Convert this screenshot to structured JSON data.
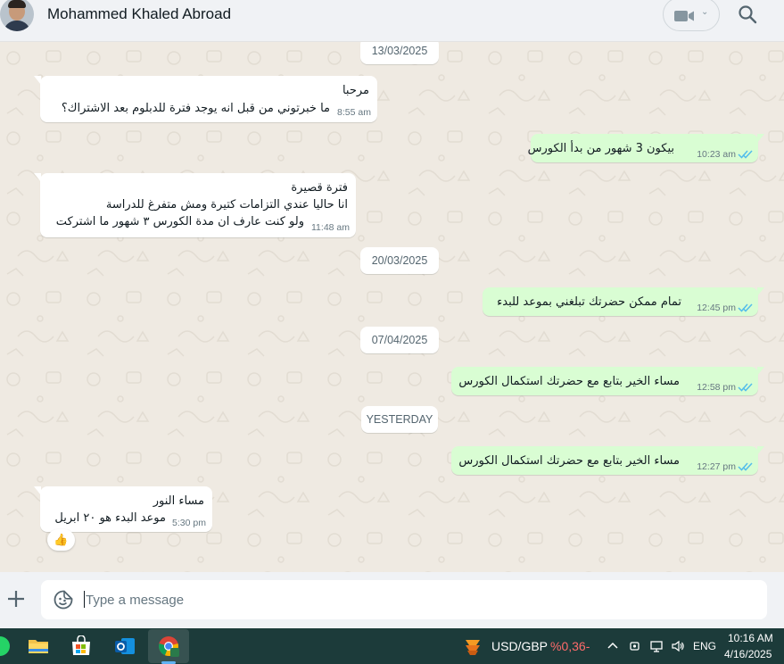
{
  "header": {
    "contact_name": "Mohammed Khaled Abroad",
    "icons": [
      "avatar",
      "video-call-icon",
      "chevron-down-icon",
      "search-icon"
    ]
  },
  "chat": {
    "dates": [
      "13/03/2025",
      "20/03/2025",
      "07/04/2025",
      "YESTERDAY"
    ],
    "messages": [
      {
        "direction": "incoming",
        "lines": [
          "مرحبا",
          "ما خبرتوني من قبل انه يوجد فترة للدبلوم بعد الاشتراك؟"
        ],
        "time": "8:55 am"
      },
      {
        "direction": "outgoing",
        "lines": [
          "بيكون 3 شهور من بدأ الكورس"
        ],
        "time": "10:23 am",
        "status": "read"
      },
      {
        "direction": "incoming",
        "lines": [
          "فترة قصيرة",
          "انا حاليا عندي التزامات كتيرة ومش متفرغ للدراسة",
          "ولو كنت عارف ان مدة الكورس ٣ شهور ما اشتركت"
        ],
        "time": "11:48 am"
      },
      {
        "direction": "outgoing",
        "lines": [
          "تمام ممكن حضرتك تبلغني بموعد للبدء"
        ],
        "time": "12:45 pm",
        "status": "read"
      },
      {
        "direction": "outgoing",
        "lines": [
          "مساء الخير بتابع مع حضرتك استكمال الكورس"
        ],
        "time": "12:58 pm",
        "status": "read"
      },
      {
        "direction": "outgoing",
        "lines": [
          "مساء الخير بتابع مع حضرتك استكمال الكورس"
        ],
        "time": "12:27 pm",
        "status": "read"
      },
      {
        "direction": "incoming",
        "lines": [
          "مساء النور",
          "موعد البدء هو ٢٠ ابريل"
        ],
        "time": "5:30 pm"
      }
    ],
    "reaction": "👍"
  },
  "composer": {
    "placeholder": "Type a message",
    "icons": [
      "plus-icon",
      "sticker-icon"
    ]
  },
  "taskbar": {
    "apps": [
      "whatsapp-icon",
      "file-explorer-icon",
      "microsoft-store-icon",
      "outlook-icon",
      "chrome-icon"
    ],
    "ticker_symbol": "USD/GBP",
    "ticker_change": "%0,36-",
    "ticker_change_color": "#ff6b6b",
    "language": "ENG",
    "time": "10:16 AM",
    "date": "4/16/2025"
  },
  "colors": {
    "incoming_bubble": "#ffffff",
    "outgoing_bubble": "#d9fdd3",
    "read_ticks": "#53bdeb",
    "chat_background": "#efeae2",
    "taskbar_background": "#1c3b3a"
  }
}
